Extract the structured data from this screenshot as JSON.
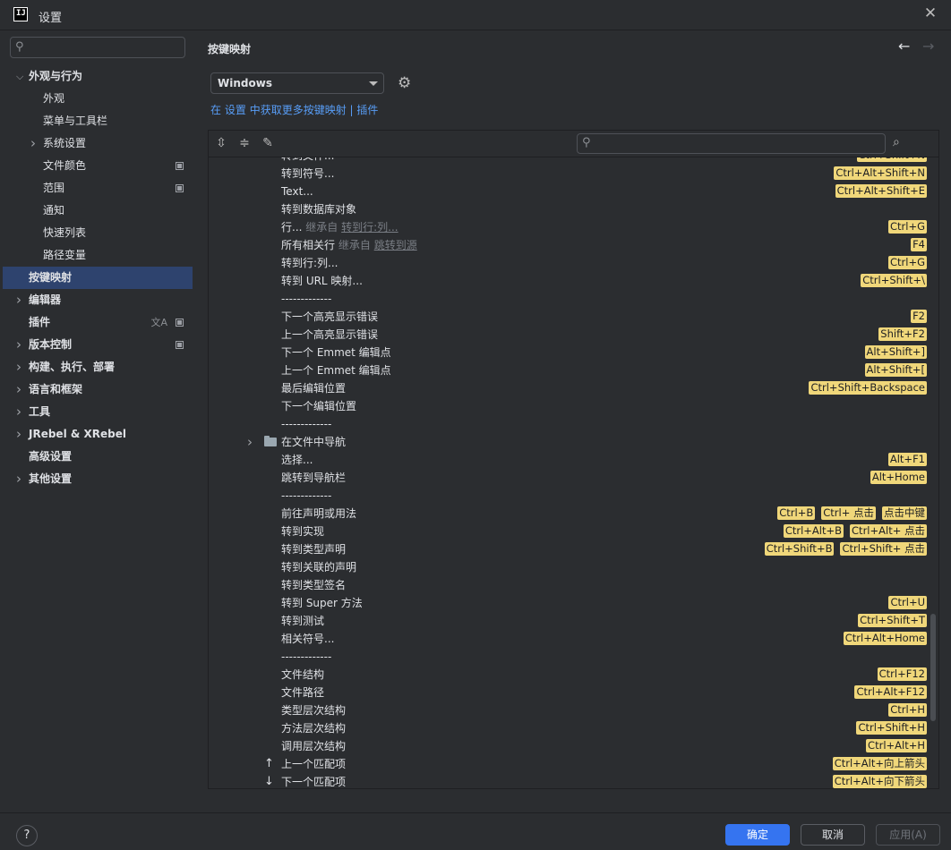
{
  "window": {
    "title": "设置",
    "logo": "IJ"
  },
  "sidebar": {
    "search_placeholder": "",
    "items": [
      {
        "label": "外观与行为",
        "level": 0,
        "chevron": "down",
        "bold": true
      },
      {
        "label": "外观",
        "level": 1
      },
      {
        "label": "菜单与工具栏",
        "level": 1
      },
      {
        "label": "系统设置",
        "level": 1,
        "chevron": "right"
      },
      {
        "label": "文件颜色",
        "level": 1,
        "icon": "project-level-icon"
      },
      {
        "label": "范围",
        "level": 1,
        "icon": "project-level-icon"
      },
      {
        "label": "通知",
        "level": 1
      },
      {
        "label": "快速列表",
        "level": 1
      },
      {
        "label": "路径变量",
        "level": 1
      },
      {
        "label": "按键映射",
        "level": 0,
        "selected": true,
        "bold": true
      },
      {
        "label": "编辑器",
        "level": 0,
        "chevron": "right",
        "bold": true
      },
      {
        "label": "插件",
        "level": 0,
        "bold": true,
        "icon": "project-level-icon",
        "icon2": "translate-icon"
      },
      {
        "label": "版本控制",
        "level": 0,
        "chevron": "right",
        "bold": true,
        "icon": "project-level-icon"
      },
      {
        "label": "构建、执行、部署",
        "level": 0,
        "chevron": "right",
        "bold": true
      },
      {
        "label": "语言和框架",
        "level": 0,
        "chevron": "right",
        "bold": true
      },
      {
        "label": "工具",
        "level": 0,
        "chevron": "right",
        "bold": true
      },
      {
        "label": "JRebel & XRebel",
        "level": 0,
        "chevron": "right",
        "bold": true
      },
      {
        "label": "高级设置",
        "level": 0,
        "bold": true
      },
      {
        "label": "其他设置",
        "level": 0,
        "chevron": "right",
        "bold": true
      }
    ]
  },
  "panel": {
    "title": "按键映射",
    "keymap_value": "Windows",
    "link_prefix": "在",
    "link_settings": "设置",
    "link_middle": "中获取更多按键映射 |",
    "link_plugins": "插件",
    "tree_search_placeholder": ""
  },
  "actions": [
    {
      "name": "转到文件...",
      "keys": [
        "Ctrl+Shift+N"
      ],
      "partial": true
    },
    {
      "name": "转到符号...",
      "keys": [
        "Ctrl+Alt+Shift+N"
      ]
    },
    {
      "name": "Text...",
      "keys": [
        "Ctrl+Alt+Shift+E"
      ]
    },
    {
      "name": "转到数据库对象",
      "keys": []
    },
    {
      "name": "行...",
      "inherit": "继承自",
      "ref": "转到行:列...",
      "keys": [
        "Ctrl+G"
      ]
    },
    {
      "name": "所有相关行",
      "inherit": "继承自",
      "ref": "跳转到源",
      "keys": [
        "F4"
      ]
    },
    {
      "name": "转到行:列...",
      "keys": [
        "Ctrl+G"
      ]
    },
    {
      "name": "转到 URL 映射...",
      "keys": [
        "Ctrl+Shift+\\"
      ]
    },
    {
      "name": "-------------",
      "keys": []
    },
    {
      "name": "下一个高亮显示错误",
      "keys": [
        "F2"
      ]
    },
    {
      "name": "上一个高亮显示错误",
      "keys": [
        "Shift+F2"
      ]
    },
    {
      "name": "下一个 Emmet 编辑点",
      "keys": [
        "Alt+Shift+]"
      ]
    },
    {
      "name": "上一个 Emmet 编辑点",
      "keys": [
        "Alt+Shift+["
      ]
    },
    {
      "name": "最后编辑位置",
      "keys": [
        "Ctrl+Shift+Backspace"
      ]
    },
    {
      "name": "下一个编辑位置",
      "keys": []
    },
    {
      "name": "-------------",
      "keys": []
    },
    {
      "name": "在文件中导航",
      "keys": [],
      "folder": true
    },
    {
      "name": "选择...",
      "keys": [
        "Alt+F1"
      ]
    },
    {
      "name": "跳转到导航栏",
      "keys": [
        "Alt+Home"
      ]
    },
    {
      "name": "-------------",
      "keys": []
    },
    {
      "name": "前往声明或用法",
      "keys": [
        "Ctrl+B",
        "Ctrl+ 点击",
        "点击中键"
      ]
    },
    {
      "name": "转到实现",
      "keys": [
        "Ctrl+Alt+B",
        "Ctrl+Alt+ 点击"
      ]
    },
    {
      "name": "转到类型声明",
      "keys": [
        "Ctrl+Shift+B",
        "Ctrl+Shift+ 点击"
      ]
    },
    {
      "name": "转到关联的声明",
      "keys": []
    },
    {
      "name": "转到类型签名",
      "keys": []
    },
    {
      "name": "转到 Super 方法",
      "keys": [
        "Ctrl+U"
      ]
    },
    {
      "name": "转到测试",
      "keys": [
        "Ctrl+Shift+T"
      ]
    },
    {
      "name": "相关符号...",
      "keys": [
        "Ctrl+Alt+Home"
      ]
    },
    {
      "name": "-------------",
      "keys": []
    },
    {
      "name": "文件结构",
      "keys": [
        "Ctrl+F12"
      ]
    },
    {
      "name": "文件路径",
      "keys": [
        "Ctrl+Alt+F12"
      ]
    },
    {
      "name": "类型层次结构",
      "keys": [
        "Ctrl+H"
      ]
    },
    {
      "name": "方法层次结构",
      "keys": [
        "Ctrl+Shift+H"
      ]
    },
    {
      "name": "调用层次结构",
      "keys": [
        "Ctrl+Alt+H"
      ]
    },
    {
      "name": "上一个匹配项",
      "keys": [
        "Ctrl+Alt+向上箭头"
      ],
      "icon": "↑"
    },
    {
      "name": "下一个匹配项",
      "keys": [
        "Ctrl+Alt+向下箭头"
      ],
      "icon": "↓"
    }
  ],
  "buttons": {
    "ok": "确定",
    "cancel": "取消",
    "apply": "应用(A)",
    "help": "?"
  }
}
